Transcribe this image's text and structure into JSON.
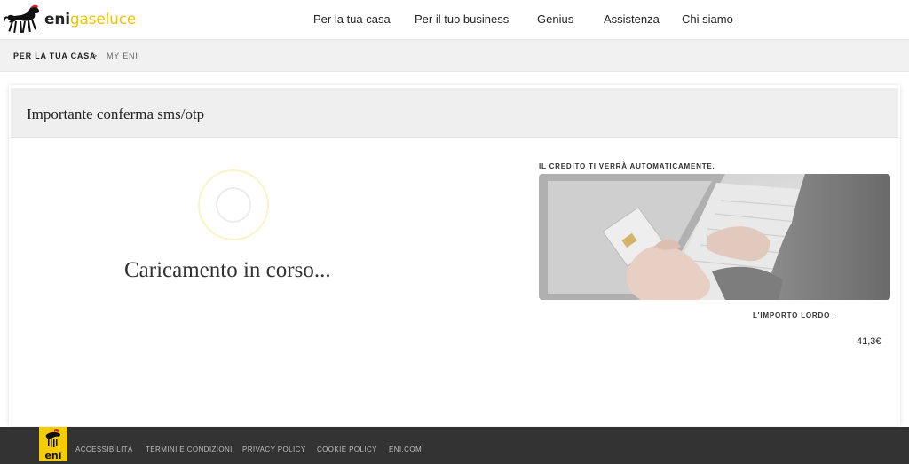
{
  "brand": {
    "name_part1": "eni",
    "name_part2": "gaseluce"
  },
  "nav": [
    {
      "label": "Per la tua casa"
    },
    {
      "label": "Per il tuo business"
    },
    {
      "label": "Genius"
    },
    {
      "label": "Assistenza"
    },
    {
      "label": "Chi siamo"
    }
  ],
  "breadcrumb": {
    "item1": "PER LA TUA CASA",
    "separator": ">",
    "item2": "MY ENI"
  },
  "card": {
    "title": "Importante conferma sms/otp",
    "loading_text": "Caricamento in corso...",
    "credit_label": "IL CREDITO TI VERRÀ AUTOMATICAMENTE.",
    "amount_label": "L'IMPORTO LORDO :",
    "amount_value": "41,3€"
  },
  "footer": {
    "logo_text": "eni",
    "links": [
      {
        "label": "ACCESSIBILITÀ"
      },
      {
        "label": "TERMINI E CONDIZIONI"
      },
      {
        "label": "PRIVACY POLICY"
      },
      {
        "label": "COOKIE POLICY"
      },
      {
        "label": "ENI.COM"
      }
    ]
  },
  "colors": {
    "brand_yellow": "#f0c300",
    "footer_bg": "#333333",
    "breadcrumb_bg": "#f1f1f1"
  }
}
